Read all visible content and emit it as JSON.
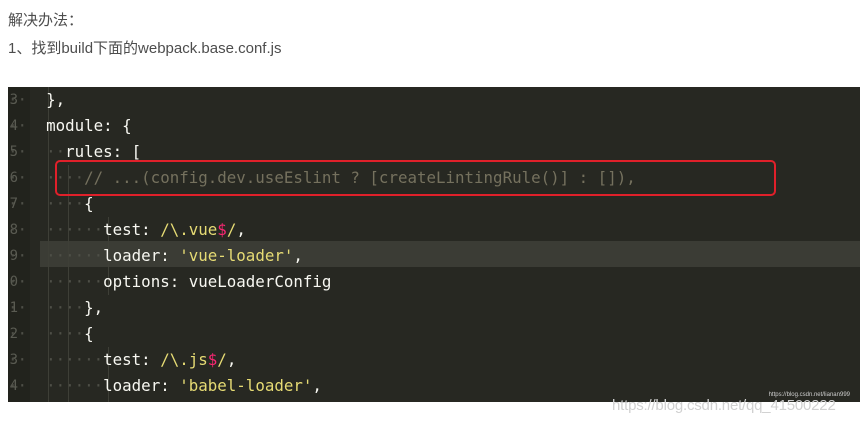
{
  "intro": {
    "line1": "解决办法：",
    "line2": "1、找到build下面的webpack.base.conf.js"
  },
  "gutter_numbers": [
    "3",
    "4",
    "5",
    "6",
    "7",
    "8",
    "9",
    "0",
    "1",
    "2",
    "3",
    "4"
  ],
  "code": {
    "line1": "},",
    "line2": "module: {",
    "line3": "rules: [",
    "line4": "// ...(config.dev.useEslint ? [createLintingRule()] : []),",
    "line5": "{",
    "line6_key": "test: ",
    "line6_a": "/\\.vue",
    "line6_b": "$",
    "line6_c": "/",
    "line6_end": ",",
    "line7_key": "loader: ",
    "line7_val": "'vue-loader'",
    "line7_end": ",",
    "line8": "options: vueLoaderConfig",
    "line9": "},",
    "line10": "{",
    "line11_key": "test: ",
    "line11_a": "/\\.js",
    "line11_b": "$",
    "line11_c": "/",
    "line11_end": ",",
    "line12_key": "loader: ",
    "line12_val": "'babel-loader'",
    "line12_end": ","
  },
  "watermark": {
    "small": "https://blog.csdn.net/lianan999",
    "large": "https://blog.csdn.net/qq_41500222"
  },
  "colors": {
    "editor_bg": "#272822",
    "highlight_box": "#e0202a",
    "string": "#e6db74",
    "comment": "#75715e"
  }
}
